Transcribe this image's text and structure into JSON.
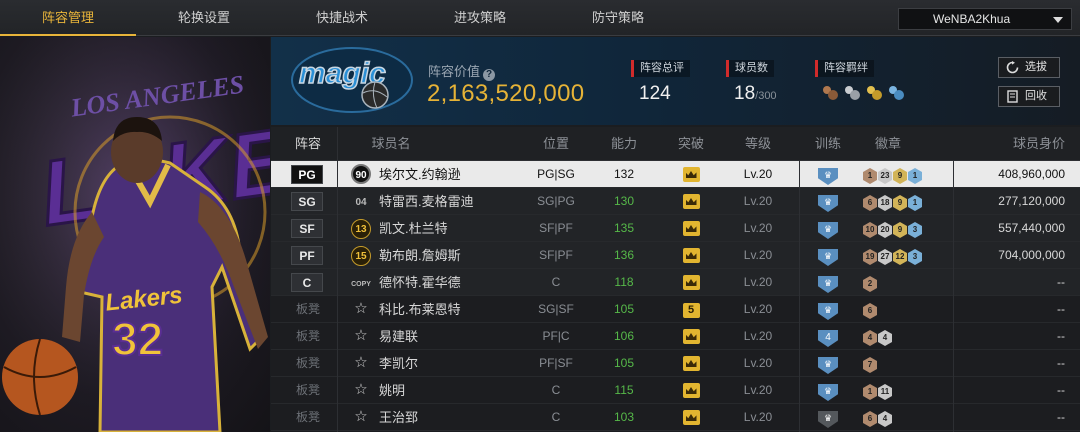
{
  "nav": {
    "tabs": [
      "阵容管理",
      "轮换设置",
      "快捷战术",
      "进攻策略",
      "防守策略"
    ],
    "active_tab": 0,
    "account": "WeNBA2Khua"
  },
  "team": {
    "value_label": "阵容价值",
    "value": "2,163,520,000",
    "stats": [
      {
        "label": "阵容总评",
        "value": "124",
        "suffix": ""
      },
      {
        "label": "球员数",
        "value": "18",
        "suffix": "/300"
      },
      {
        "label": "阵容羁绊",
        "value": "",
        "suffix": ""
      }
    ],
    "buttons": {
      "select": "选拔",
      "recycle": "回收"
    }
  },
  "table": {
    "headers": [
      "阵容",
      "球员名",
      "位置",
      "能力",
      "突破",
      "等级",
      "训练",
      "徽章",
      "球员身价"
    ],
    "rows": [
      {
        "slot": "PG",
        "bench": false,
        "ovr": "90",
        "ovr_style": "dark",
        "name": "埃尔文.约翰逊",
        "position": "PG|SG",
        "ability": "132",
        "ability_green": false,
        "breakthrough": "crown",
        "level": "Lv.20",
        "training": "shield",
        "badges": [
          [
            "1",
            "br"
          ],
          [
            "23",
            "sv"
          ],
          [
            "9",
            "gd"
          ],
          [
            "1",
            "hf"
          ]
        ],
        "salary": "408,960,000",
        "selected": true
      },
      {
        "slot": "SG",
        "bench": false,
        "ovr": "04",
        "ovr_style": "plain",
        "name": "特雷西.麦格雷迪",
        "position": "SG|PG",
        "ability": "130",
        "ability_green": true,
        "breakthrough": "crown",
        "level": "Lv.20",
        "training": "shield",
        "badges": [
          [
            "6",
            "br"
          ],
          [
            "18",
            "sv"
          ],
          [
            "9",
            "gd"
          ],
          [
            "1",
            "hf"
          ]
        ],
        "salary": "277,120,000",
        "selected": false
      },
      {
        "slot": "SF",
        "bench": false,
        "ovr": "13",
        "ovr_style": "gold",
        "name": "凯文.杜兰特",
        "position": "SF|PF",
        "ability": "135",
        "ability_green": true,
        "breakthrough": "crown",
        "level": "Lv.20",
        "training": "shield",
        "badges": [
          [
            "10",
            "br"
          ],
          [
            "20",
            "sv"
          ],
          [
            "9",
            "gd"
          ],
          [
            "3",
            "hf"
          ]
        ],
        "salary": "557,440,000",
        "selected": false
      },
      {
        "slot": "PF",
        "bench": false,
        "ovr": "15",
        "ovr_style": "gold",
        "name": "勒布朗.詹姆斯",
        "position": "SF|PF",
        "ability": "136",
        "ability_green": true,
        "breakthrough": "crown",
        "level": "Lv.20",
        "training": "shield",
        "badges": [
          [
            "19",
            "br"
          ],
          [
            "27",
            "sv"
          ],
          [
            "12",
            "gd"
          ],
          [
            "3",
            "hf"
          ]
        ],
        "salary": "704,000,000",
        "selected": false
      },
      {
        "slot": "C",
        "bench": false,
        "ovr": "COPY",
        "ovr_style": "copy",
        "name": "德怀特.霍华德",
        "position": "C",
        "ability": "118",
        "ability_green": true,
        "breakthrough": "crown",
        "level": "Lv.20",
        "training": "shield",
        "badges": [
          [
            "2",
            "br"
          ]
        ],
        "salary": "--",
        "selected": false
      },
      {
        "slot": "板凳",
        "bench": true,
        "ovr": "☆",
        "ovr_style": "star",
        "name": "科比.布莱恩特",
        "position": "SG|SF",
        "ability": "105",
        "ability_green": true,
        "breakthrough": "5",
        "level": "Lv.20",
        "training": "shield",
        "badges": [
          [
            "6",
            "br"
          ]
        ],
        "salary": "--",
        "selected": false
      },
      {
        "slot": "板凳",
        "bench": true,
        "ovr": "☆",
        "ovr_style": "star",
        "name": "易建联",
        "position": "PF|C",
        "ability": "106",
        "ability_green": true,
        "breakthrough": "crown",
        "level": "Lv.20",
        "training": "4",
        "badges": [
          [
            "4",
            "br"
          ],
          [
            "4",
            "sv"
          ]
        ],
        "salary": "--",
        "selected": false
      },
      {
        "slot": "板凳",
        "bench": true,
        "ovr": "☆",
        "ovr_style": "star",
        "name": "李凯尔",
        "position": "PF|SF",
        "ability": "105",
        "ability_green": true,
        "breakthrough": "crown",
        "level": "Lv.20",
        "training": "shield",
        "badges": [
          [
            "7",
            "br"
          ]
        ],
        "salary": "--",
        "selected": false
      },
      {
        "slot": "板凳",
        "bench": true,
        "ovr": "☆",
        "ovr_style": "star",
        "name": "姚明",
        "position": "C",
        "ability": "115",
        "ability_green": true,
        "breakthrough": "crown",
        "level": "Lv.20",
        "training": "shield",
        "badges": [
          [
            "1",
            "br"
          ],
          [
            "11",
            "sv"
          ]
        ],
        "salary": "--",
        "selected": false
      },
      {
        "slot": "板凳",
        "bench": true,
        "ovr": "☆",
        "ovr_style": "star",
        "name": "王治郅",
        "position": "C",
        "ability": "103",
        "ability_green": true,
        "breakthrough": "crown",
        "level": "Lv.20",
        "training": "grey",
        "badges": [
          [
            "6",
            "br"
          ],
          [
            "4",
            "sv"
          ]
        ],
        "salary": "--",
        "selected": false
      }
    ]
  },
  "colors": {
    "accent": "#e8b43a",
    "team_blue": "#0b77bd",
    "lakers_purple": "#552583",
    "lakers_gold": "#fdb927"
  },
  "hero_text": {
    "city": "LOS ANGELES",
    "team": "LAKERS",
    "jersey_team": "Lakers",
    "jersey_number": "32"
  },
  "logo_text": "magic"
}
